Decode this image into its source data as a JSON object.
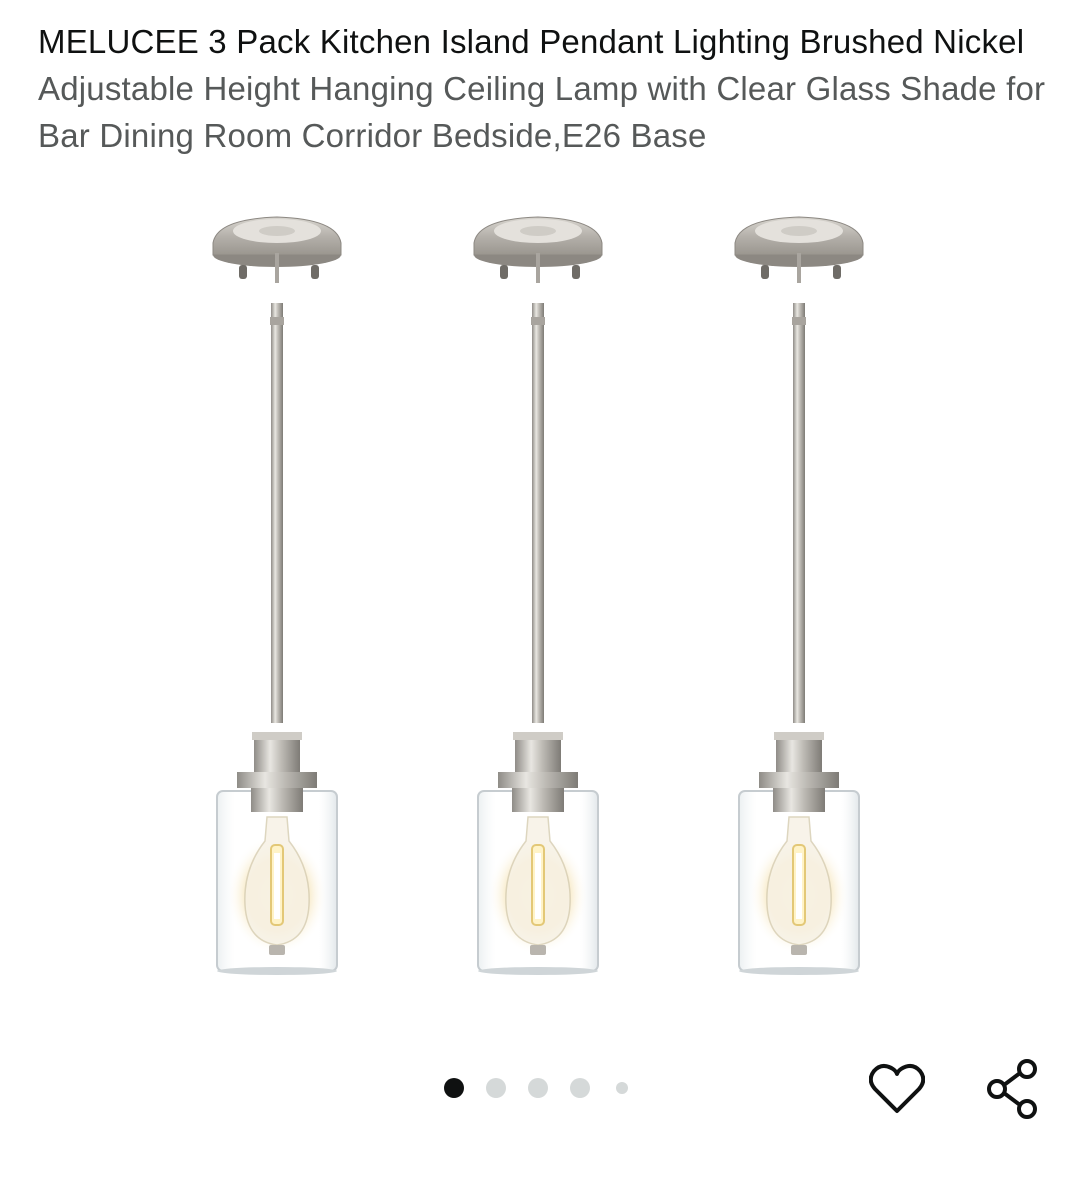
{
  "product": {
    "title": "MELUCEE 3 Pack Kitchen Island Pendant Lighting Brushed Nickel",
    "subtitle": "Adjustable Height Hanging Ceiling Lamp with Clear Glass Shade for Bar Dining Room Corridor Bedside,E26 Base"
  },
  "gallery": {
    "image_count": 5,
    "active_index": 0
  },
  "actions": {
    "wishlist_icon": "heart-outline-icon",
    "share_icon": "share-icon"
  },
  "colors": {
    "text_primary": "#0f1111",
    "text_secondary": "#565959",
    "dot_inactive": "#d5d9d9",
    "dot_active": "#0f1111"
  }
}
